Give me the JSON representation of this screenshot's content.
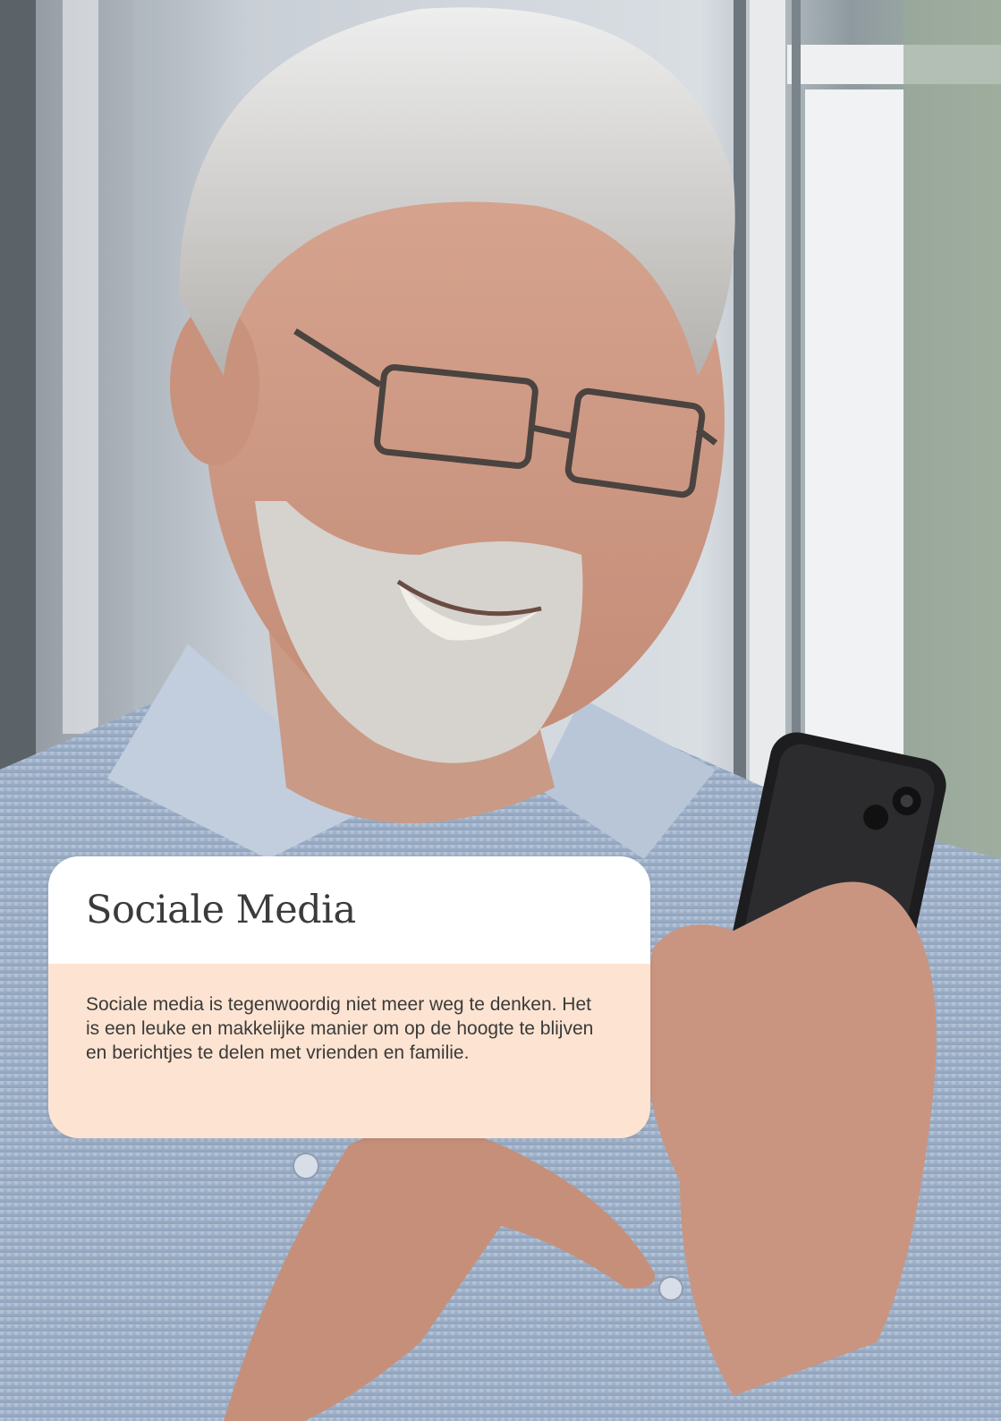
{
  "card": {
    "title": "Sociale Media",
    "text": "Sociale media is tegenwoordig niet meer weg te denken. Het is een leuke en makkelijke manier om op de hoogte te blijven en berichtjes te delen met vrienden en familie."
  },
  "colors": {
    "card_header_bg": "#ffffff",
    "card_body_bg": "#fde4d2",
    "title_color": "#3b3b3b",
    "text_color": "#3a3a3a"
  }
}
